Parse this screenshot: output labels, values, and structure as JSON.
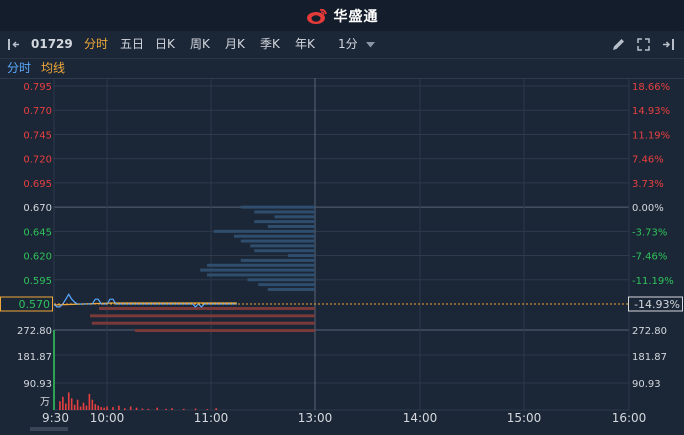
{
  "brand": {
    "name": "华盛通"
  },
  "toolbar": {
    "stock_code": "01729",
    "periods": [
      "分时",
      "五日",
      "日K",
      "周K",
      "月K",
      "季K",
      "年K"
    ],
    "active_period": "分时",
    "interval": "1分"
  },
  "legend": {
    "items": [
      "分时",
      "均线"
    ]
  },
  "colors": {
    "background": "#1b2636",
    "grid": "#2e3a4d",
    "up": "#e84040",
    "down": "#2fc25b",
    "price_line": "#5aa9ff",
    "avg_line": "#f0a93a",
    "neutral": "#d4d8de",
    "accent": "#f0a93a"
  },
  "chart_data": {
    "type": "line",
    "price_axis": {
      "labels": [
        "0.795",
        "0.770",
        "0.745",
        "0.720",
        "0.695",
        "0.670",
        "0.645",
        "0.620",
        "0.595",
        "0.570"
      ],
      "values": [
        0.795,
        0.77,
        0.745,
        0.72,
        0.695,
        0.67,
        0.645,
        0.62,
        0.595,
        0.57
      ],
      "ylim": [
        0.565,
        0.795
      ]
    },
    "percent_axis": {
      "labels": [
        "18.66%",
        "14.93%",
        "11.19%",
        "7.46%",
        "3.73%",
        "0.00%",
        "-3.73%",
        "-7.46%",
        "-11.19%",
        "-14.93%"
      ]
    },
    "prev_close": 0.67,
    "current_price": {
      "price": "0.570",
      "percent": "-14.93%",
      "value": 0.57
    },
    "volume_axis": {
      "labels": [
        "272.80",
        "181.87",
        "90.93"
      ],
      "unit": "万",
      "max": 272.8
    },
    "x_labels": [
      "9:30",
      "10:00",
      "11:00",
      "13:00",
      "14:00",
      "15:00",
      "16:00"
    ],
    "price_series": {
      "minutes": [
        0,
        2,
        4,
        6,
        8,
        10,
        12,
        14,
        16,
        18,
        20,
        22,
        24,
        26,
        28,
        30,
        32,
        34,
        36,
        38,
        40,
        42,
        44,
        46,
        48,
        50,
        52,
        54,
        56,
        58,
        60,
        62,
        64,
        66,
        68,
        70,
        72,
        74,
        76,
        78,
        80,
        82,
        84,
        86,
        88,
        90,
        92,
        94,
        96,
        98,
        100,
        102,
        104,
        106,
        108,
        110,
        112,
        114,
        116,
        118,
        120,
        122,
        124
      ],
      "values": [
        0.57,
        0.567,
        0.567,
        0.57,
        0.575,
        0.58,
        0.575,
        0.572,
        0.57,
        0.57,
        0.57,
        0.57,
        0.57,
        0.57,
        0.575,
        0.575,
        0.57,
        0.57,
        0.57,
        0.575,
        0.575,
        0.57,
        0.57,
        0.57,
        0.57,
        0.57,
        0.57,
        0.57,
        0.57,
        0.57,
        0.57,
        0.57,
        0.57,
        0.57,
        0.57,
        0.57,
        0.57,
        0.57,
        0.57,
        0.57,
        0.57,
        0.57,
        0.57,
        0.57,
        0.57,
        0.57,
        0.57,
        0.57,
        0.567,
        0.57,
        0.567,
        0.57,
        0.57,
        0.57,
        0.57,
        0.57,
        0.57,
        0.57,
        0.57,
        0.57,
        0.57,
        0.57,
        0.57
      ]
    },
    "avg_series": {
      "minutes": [
        0,
        10,
        20,
        30,
        40,
        50,
        60,
        70,
        80,
        90,
        100,
        110,
        124
      ],
      "values": [
        0.569,
        0.5695,
        0.57,
        0.5705,
        0.571,
        0.571,
        0.571,
        0.571,
        0.571,
        0.571,
        0.571,
        0.571,
        0.571
      ]
    },
    "volume_series": {
      "minutes": [
        0,
        4,
        6,
        8,
        10,
        12,
        14,
        16,
        18,
        20,
        22,
        24,
        26,
        28,
        30,
        32,
        34,
        36,
        40,
        44,
        48,
        52,
        56,
        60,
        64,
        70,
        76,
        80,
        88,
        96,
        104,
        110
      ],
      "values": [
        272.8,
        30,
        45,
        22,
        60,
        40,
        18,
        35,
        12,
        25,
        15,
        55,
        35,
        20,
        15,
        10,
        8,
        12,
        10,
        15,
        6,
        12,
        8,
        5,
        4,
        8,
        4,
        6,
        4,
        5,
        3,
        6
      ],
      "up": [
        true,
        true,
        true,
        true,
        true,
        true,
        true,
        true,
        true,
        true,
        true,
        true,
        true,
        true,
        true,
        true,
        true,
        true,
        true,
        true,
        true,
        true,
        true,
        true,
        true,
        true,
        true,
        true,
        true,
        true,
        true,
        true
      ]
    },
    "order_depth": {
      "ask": {
        "prices": [
          0.67,
          0.665,
          0.66,
          0.655,
          0.65,
          0.645,
          0.64,
          0.635,
          0.63,
          0.625,
          0.62,
          0.615,
          0.61,
          0.605,
          0.6,
          0.595,
          0.59,
          0.585
        ],
        "volumes": [
          0.55,
          0.45,
          0.3,
          0.45,
          0.35,
          0.75,
          0.6,
          0.55,
          0.48,
          0.45,
          0.2,
          0.55,
          0.8,
          0.85,
          0.8,
          0.5,
          0.42,
          0.35
        ]
      },
      "bid": {
        "prices": [
          0.57,
          0.565,
          0.56,
          0.555
        ],
        "volumes": [
          0.6,
          0.65,
          0.62,
          0.5
        ]
      }
    }
  }
}
